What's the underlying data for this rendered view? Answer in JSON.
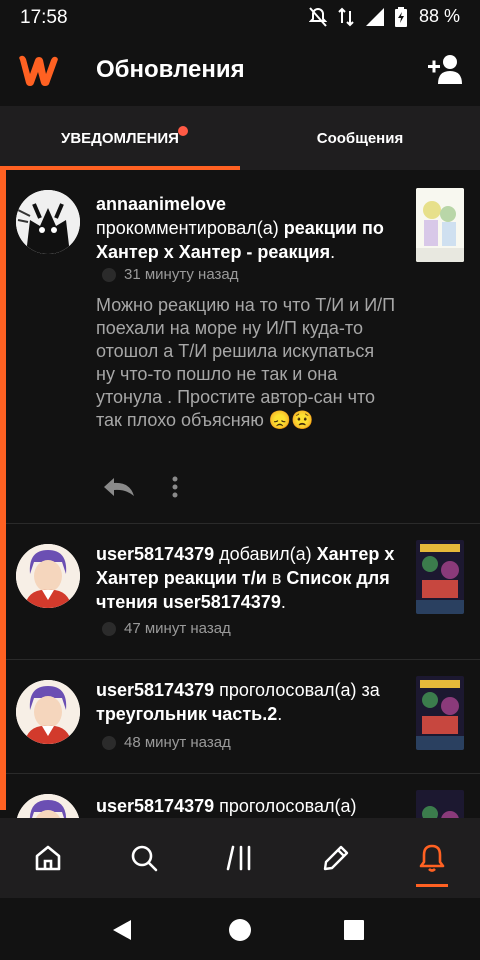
{
  "status": {
    "time": "17:58",
    "battery": "88 %"
  },
  "appbar": {
    "title": "Обновления"
  },
  "tabs": [
    {
      "label": "УВЕДОМЛЕНИЯ",
      "active": true,
      "has_dot": true
    },
    {
      "label": "Сообщения",
      "active": false
    }
  ],
  "notifications": [
    {
      "user": "annaanimelove",
      "action": " прокомментировал(а) ",
      "target": "реакции по Хантер х Хантер - реакция",
      "suffix": ".",
      "time": "31 минуту назад",
      "comment": "Можно реакцию на то что Т/И и И/П поехали на море ну И/П куда-то отошол а Т/И решила искупаться ну что-то пошло не так и она утонула . Простите автор-сан что так плохо объясняю 😞😟"
    },
    {
      "user": "user58174379",
      "action": " добавил(а) ",
      "target": "Хантер х Хантер реакции т/и",
      "mid": " в ",
      "target2": "Список для чтения user58174379",
      "suffix": ".",
      "time": "47 минут назад"
    },
    {
      "user": "user58174379",
      "action": " проголосовал(а) за ",
      "target": "треугольник часть.2",
      "suffix": ".",
      "time": "48 минут назад"
    },
    {
      "user": "user58174379",
      "action": " проголосовал(а)"
    }
  ],
  "colors": {
    "accent": "#ff6122",
    "background": "#121212",
    "surface": "#1f1e1f"
  },
  "nav_icons": [
    "home-icon",
    "search-icon",
    "library-icon",
    "write-icon",
    "bell-icon"
  ]
}
